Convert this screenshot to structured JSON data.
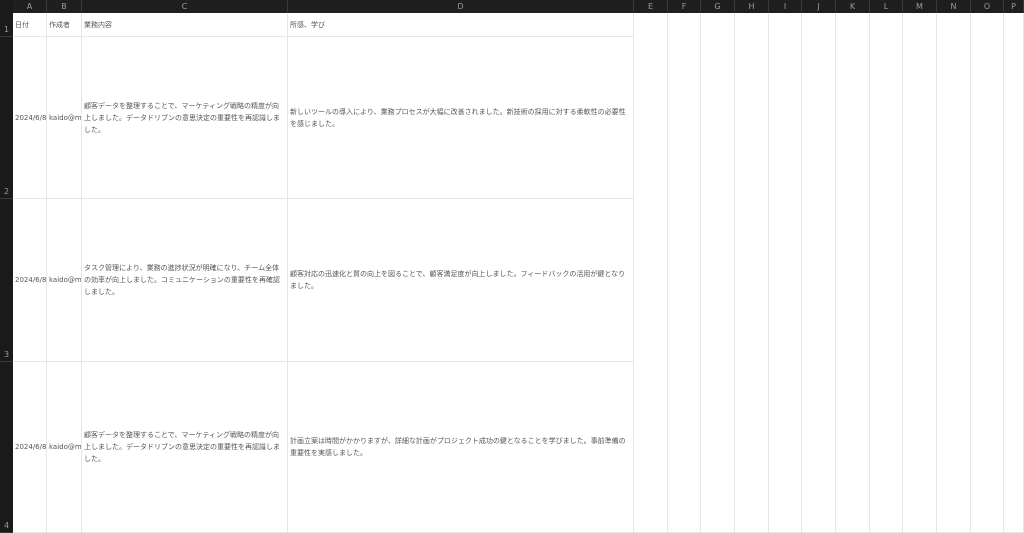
{
  "columns": [
    "A",
    "B",
    "C",
    "D",
    "E",
    "F",
    "G",
    "H",
    "I",
    "J",
    "K",
    "L",
    "M",
    "N",
    "O",
    "P"
  ],
  "rows": [
    "1",
    "2",
    "3",
    "4"
  ],
  "header": [
    "日付",
    "作成者",
    "業務内容",
    "所感、学び"
  ],
  "data_rows": [
    {
      "date": "2024/6/8",
      "author": "kaido@mo",
      "task": "顧客データを整理することで、マーケティング戦略の精度が向上しました。データドリブンの意思決定の重要性を再認識しました。",
      "reflection": "新しいツールの導入により、業務プロセスが大幅に改善されました。新技術の採用に対する柔軟性の必要性を感じました。"
    },
    {
      "date": "2024/6/8",
      "author": "kaido@mo",
      "task": "タスク管理により、業務の進捗状況が明確になり、チーム全体の効率が向上しました。コミュニケーションの重要性を再確認しました。",
      "reflection": "顧客対応の迅速化と質の向上を図ることで、顧客満足度が向上しました。フィードバックの活用が鍵となりました。"
    },
    {
      "date": "2024/6/8",
      "author": "kaido@mo",
      "task": "顧客データを整理することで、マーケティング戦略の精度が向上しました。データドリブンの意思決定の重要性を再認識しました。",
      "reflection": "計画立案は時間がかかりますが、詳細な計画がプロジェクト成功の鍵となることを学びました。事前準備の重要性を実感しました。"
    }
  ]
}
